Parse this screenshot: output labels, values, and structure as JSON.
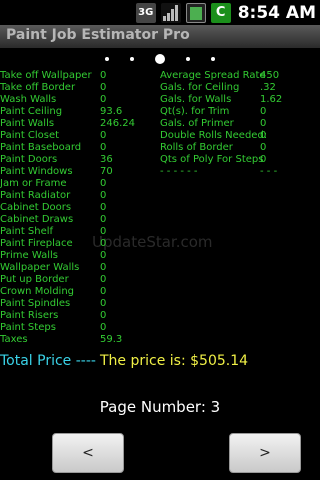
{
  "status_bar": {
    "time": "8:54",
    "ampm": "AM",
    "network_badge": "3G",
    "app_badge": "C"
  },
  "app": {
    "title": "Paint Job Estimator Pro"
  },
  "pager": {
    "dot_count": 5,
    "active_index": 2
  },
  "rows": [
    {
      "label": "Take off Wallpaper",
      "value": "0",
      "label2": "Average Spread Rate",
      "value2": "450"
    },
    {
      "label": "Take off Border",
      "value": "0",
      "label2": "Gals. for Ceiling",
      "value2": ".32"
    },
    {
      "label": "Wash Walls",
      "value": "0",
      "label2": "Gals. for Walls",
      "value2": "1.62"
    },
    {
      "label": "Paint Ceiling",
      "value": "93.6",
      "label2": "Qt(s). for Trim",
      "value2": "0"
    },
    {
      "label": "Paint Walls",
      "value": "246.24",
      "label2": "Gals. of Primer",
      "value2": "0"
    },
    {
      "label": "Paint Closet",
      "value": "0",
      "label2": "Double Rolls Needed:",
      "value2": "0"
    },
    {
      "label": "Paint Baseboard",
      "value": "0",
      "label2": "Rolls of Border",
      "value2": "0"
    },
    {
      "label": "Paint Doors",
      "value": "36",
      "label2": "Qts of Poly For Steps",
      "value2": "0"
    },
    {
      "label": "Paint Windows",
      "value": "70",
      "label2": "- - - - - -",
      "value2": "- - -"
    },
    {
      "label": "Jam or Frame",
      "value": "0"
    },
    {
      "label": "Paint Radiator",
      "value": "0"
    },
    {
      "label": "Cabinet Doors",
      "value": "0"
    },
    {
      "label": "Cabinet Draws",
      "value": "0"
    },
    {
      "label": "Paint Shelf",
      "value": "0"
    },
    {
      "label": "Paint Fireplace",
      "value": "0"
    },
    {
      "label": "Prime Walls",
      "value": "0"
    },
    {
      "label": "Wallpaper Walls",
      "value": "0"
    },
    {
      "label": "Put up Border",
      "value": "0"
    },
    {
      "label": "Crown Molding",
      "value": "0"
    },
    {
      "label": "Paint Spindles",
      "value": "0"
    },
    {
      "label": "Paint Risers",
      "value": "0"
    },
    {
      "label": "Paint Steps",
      "value": "0"
    },
    {
      "label": "Taxes",
      "value": "59.3"
    }
  ],
  "total": {
    "label": "Total Price ----",
    "price_text": "The price is: $505.14"
  },
  "page_number_text": "Page Number: 3",
  "nav": {
    "prev_label": "<",
    "next_label": ">"
  },
  "watermark": "UpdateStar.com",
  "colors": {
    "label_green": "#33cc33",
    "total_cyan": "#3ad3e8",
    "price_yellow": "#f0f046",
    "background": "#000000"
  }
}
